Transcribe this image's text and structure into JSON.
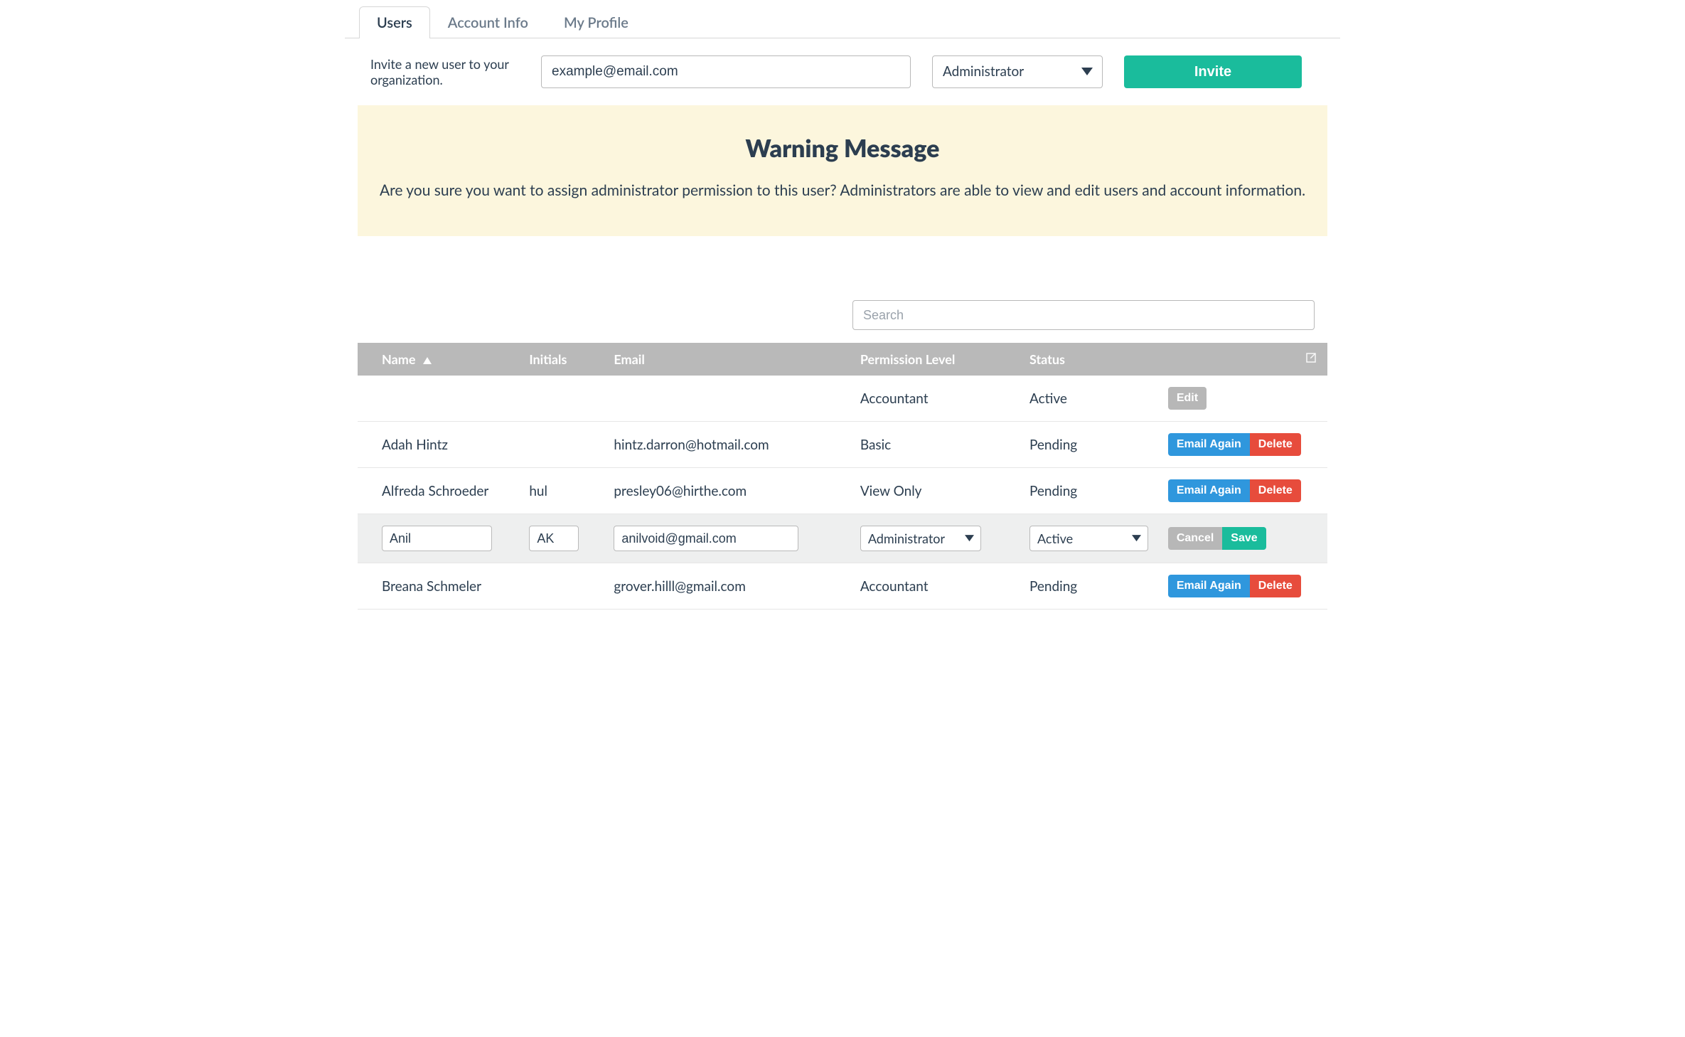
{
  "tabs": {
    "users": "Users",
    "account_info": "Account Info",
    "my_profile": "My Profile",
    "active": "users"
  },
  "invite": {
    "label": "Invite a new user to your organization.",
    "email_value": "example@email.com",
    "role_selected": "Administrator",
    "button": "Invite"
  },
  "warning": {
    "title": "Warning Message",
    "body": "Are you sure you want to assign administrator permission to this user? Administrators are able to view and edit users and account information."
  },
  "search": {
    "placeholder": "Search",
    "value": ""
  },
  "table": {
    "headers": {
      "name": "Name",
      "initials": "Initials",
      "email": "Email",
      "permission": "Permission Level",
      "status": "Status"
    },
    "sort": {
      "column": "name",
      "direction": "asc"
    },
    "actions": {
      "edit": "Edit",
      "email_again": "Email Again",
      "delete": "Delete",
      "cancel": "Cancel",
      "save": "Save"
    },
    "rows": [
      {
        "name": "",
        "initials": "",
        "email": "",
        "permission": "Accountant",
        "status": "Active",
        "mode": "self"
      },
      {
        "name": "Adah Hintz",
        "initials": "",
        "email": "hintz.darron@hotmail.com",
        "permission": "Basic",
        "status": "Pending",
        "mode": "pending"
      },
      {
        "name": "Alfreda Schroeder",
        "initials": "hul",
        "email": "presley06@hirthe.com",
        "permission": "View Only",
        "status": "Pending",
        "mode": "pending"
      },
      {
        "name": "Anil",
        "initials": "AK",
        "email": "anilvoid@gmail.com",
        "permission": "Administrator",
        "status": "Active",
        "mode": "editing"
      },
      {
        "name": "Breana Schmeler",
        "initials": "",
        "email": "grover.hilll@gmail.com",
        "permission": "Accountant",
        "status": "Pending",
        "mode": "pending"
      }
    ]
  }
}
